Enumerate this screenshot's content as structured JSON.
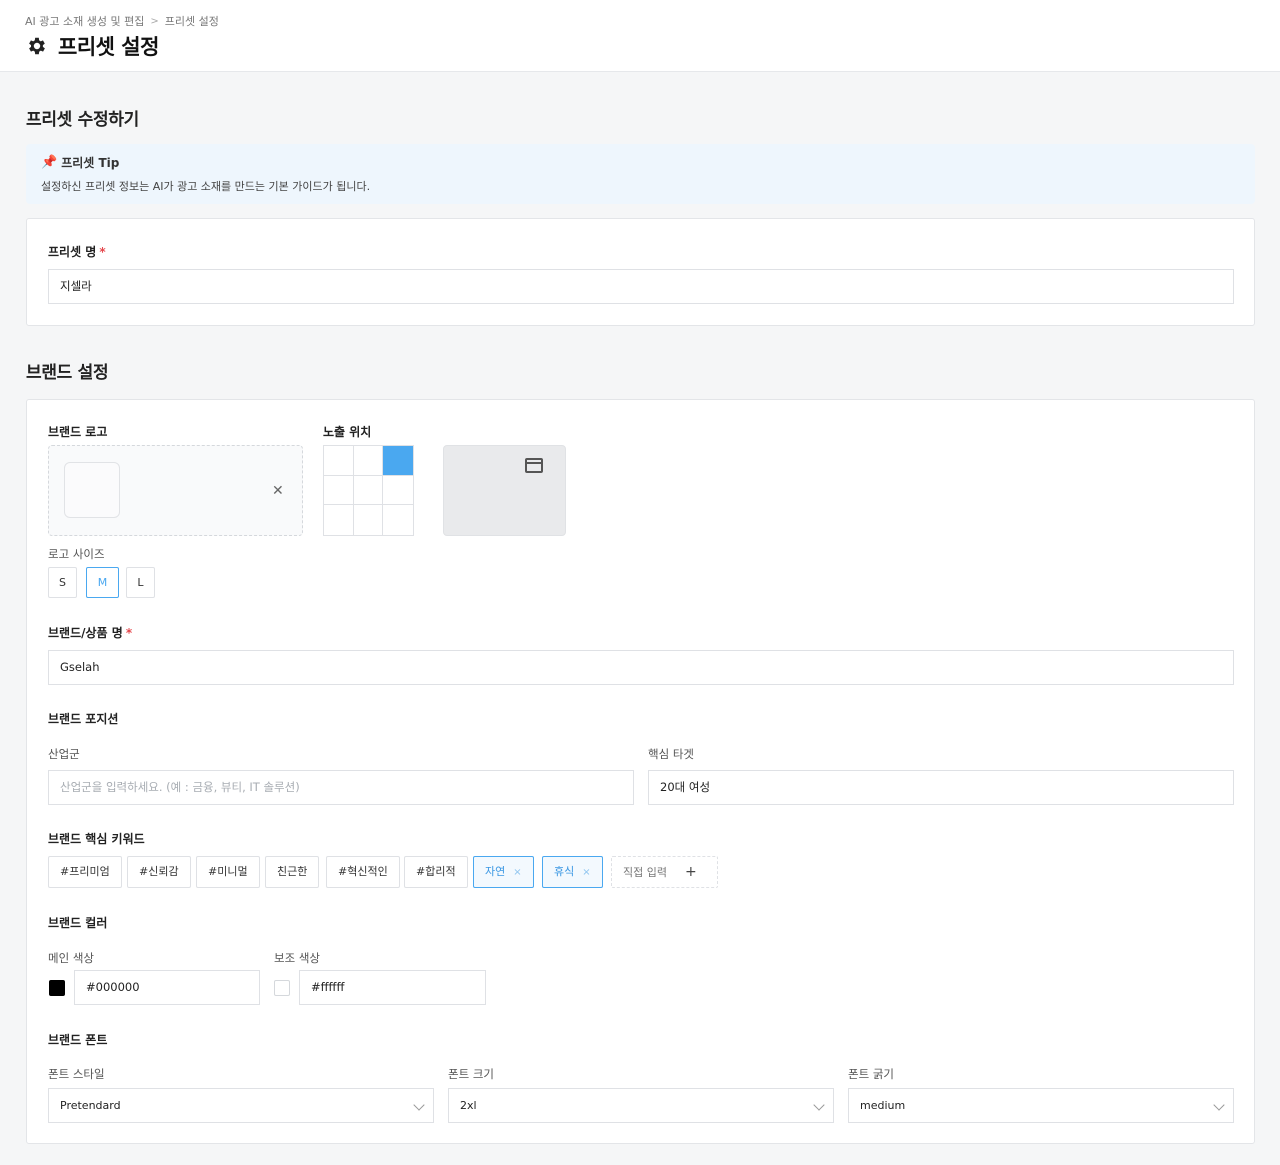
{
  "breadcrumb": {
    "items": [
      "AI 광고 소재 생성 및 편집",
      "프리셋 설정"
    ],
    "separator": ">"
  },
  "page": {
    "title": "프리셋 설정",
    "icon": "gear-icon"
  },
  "preset_section": {
    "title": "프리셋 수정하기"
  },
  "tip": {
    "icon": "pushpin-icon",
    "title": "프리셋 Tip",
    "description": "설정하신 프리셋 정보는 AI가 광고 소재를 만드는 기본 가이드가 됩니다."
  },
  "preset_name": {
    "label": "프리셋 명",
    "required": "*",
    "value": "지셀라"
  },
  "brand_section": {
    "title": "브랜드 설정"
  },
  "brand_logo": {
    "label": "브랜드 로고",
    "remove_icon": "close-icon"
  },
  "position": {
    "label": "노출 위치",
    "selected_cell": 3,
    "preview_icon": "window-icon"
  },
  "logo_size": {
    "label": "로고 사이즈",
    "options": [
      "S",
      "M",
      "L"
    ],
    "selected": "M"
  },
  "brand_name": {
    "label": "브랜드/상품 명",
    "required": "*",
    "value": "Gselah"
  },
  "positioning": {
    "label": "브랜드 포지션",
    "industry": {
      "label": "산업군",
      "value": "",
      "placeholder": "산업군을 입력하세요. (예 : 금융, 뷰티, IT 솔루션)"
    },
    "target": {
      "label": "핵심 타겟",
      "value": "20대 여성"
    }
  },
  "keywords": {
    "label": "브랜드 핵심 키워드",
    "chips": [
      "#프리미엄",
      "#신뢰감",
      "#미니멀",
      "친근한",
      "#혁신적인",
      "#합리적"
    ],
    "selected_chips": [
      "자연",
      "휴식"
    ],
    "remove_symbol": "×",
    "add_label": "직접 입력",
    "add_symbol": "+"
  },
  "colors": {
    "label": "브랜드 컬러",
    "main": {
      "label": "메인 색상",
      "value": "#000000"
    },
    "sub": {
      "label": "보조 색상",
      "value": "#ffffff"
    }
  },
  "fonts": {
    "label": "브랜드 폰트",
    "style": {
      "label": "폰트 스타일",
      "value": "Pretendard"
    },
    "size": {
      "label": "폰트 크기",
      "value": "2xl"
    },
    "weight": {
      "label": "폰트 굵기",
      "value": "medium"
    }
  },
  "accent_color": "#4aa8f0",
  "required_color": "#e5484d"
}
